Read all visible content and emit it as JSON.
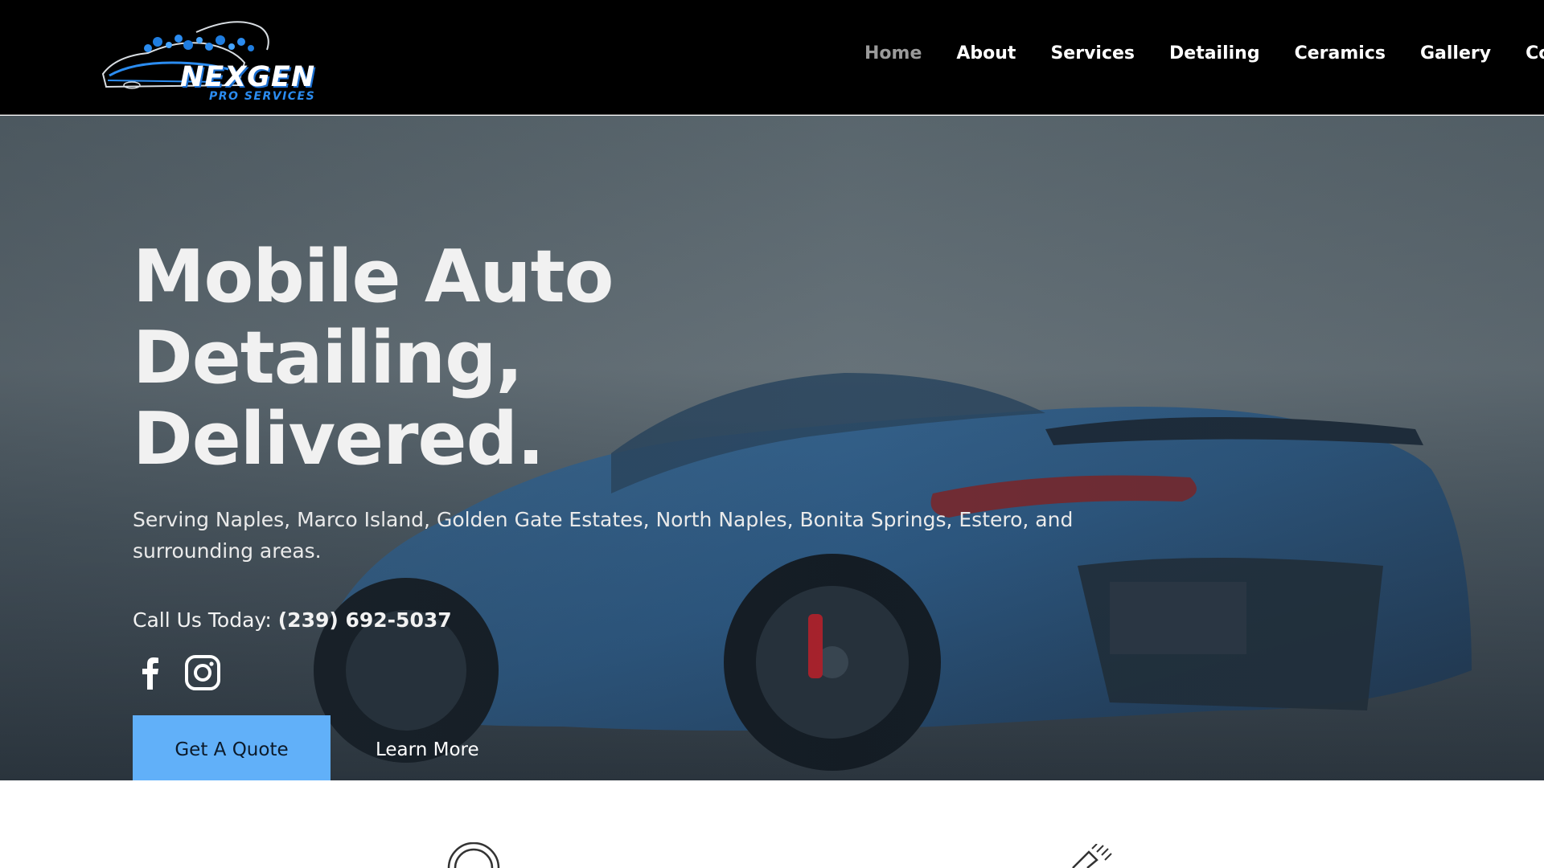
{
  "header": {
    "logo": {
      "wordmark": "NEXGEN",
      "tagline": "PRO SERVICES"
    },
    "nav": [
      {
        "label": "Home",
        "active": true
      },
      {
        "label": "About",
        "active": false
      },
      {
        "label": "Services",
        "active": false
      },
      {
        "label": "Detailing",
        "active": false
      },
      {
        "label": "Ceramics",
        "active": false
      },
      {
        "label": "Gallery",
        "active": false
      },
      {
        "label": "Contac",
        "active": false
      }
    ]
  },
  "hero": {
    "title_line1": "Mobile Auto Detailing,",
    "title_line2": "Delivered.",
    "subtitle": "Serving Naples, Marco Island, Golden Gate Estates, North Naples, Bonita Springs, Estero, and surrounding areas.",
    "call_label": "Call Us Today:",
    "phone": "(239) 692-5037",
    "socials": [
      {
        "icon": "facebook-icon"
      },
      {
        "icon": "instagram-icon"
      }
    ],
    "primary_button": "Get A Quote",
    "secondary_button": "Learn More"
  },
  "colors": {
    "header_bg": "#000000",
    "accent": "#61b0f9",
    "nav_active": "#9a9a9a",
    "logo_blue": "#2b8cf0"
  }
}
